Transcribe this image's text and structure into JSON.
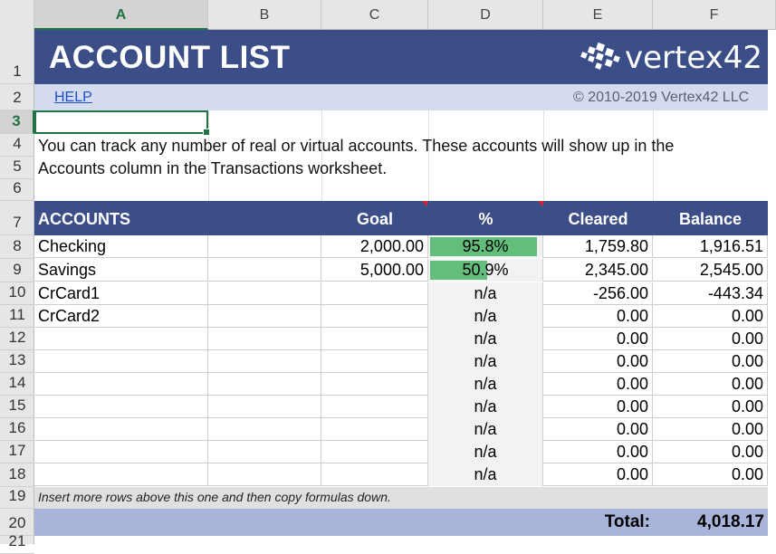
{
  "columns": [
    "A",
    "B",
    "C",
    "D",
    "E",
    "F"
  ],
  "row_numbers": [
    "1",
    "2",
    "3",
    "4",
    "5",
    "6",
    "7",
    "8",
    "9",
    "10",
    "11",
    "12",
    "13",
    "14",
    "15",
    "16",
    "17",
    "18",
    "19",
    "20",
    "21"
  ],
  "active_column": "A",
  "active_row": "3",
  "banner": {
    "title": "ACCOUNT LIST",
    "logo_text": "vertex42",
    "help_link": "HELP",
    "copyright": "© 2010-2019 Vertex42 LLC",
    "banner_color": "#3b4e87",
    "subbar_color": "#d5dbee"
  },
  "description": [
    "You can track any number of real or virtual accounts. These accounts will show up in the",
    "Accounts column in the Transactions worksheet."
  ],
  "table": {
    "headers": [
      "ACCOUNTS",
      "Goal",
      "%",
      "Cleared",
      "Balance"
    ],
    "rows": [
      {
        "account": "Checking",
        "goal": "2,000.00",
        "pct": "95.8%",
        "pct_fill": 0.958,
        "cleared": "1,759.80",
        "balance": "1,916.51"
      },
      {
        "account": "Savings",
        "goal": "5,000.00",
        "pct": "50.9%",
        "pct_fill": 0.509,
        "cleared": "2,345.00",
        "balance": "2,545.00"
      },
      {
        "account": "CrCard1",
        "goal": "",
        "pct": "n/a",
        "pct_fill": 0,
        "cleared": "-256.00",
        "balance": "-443.34"
      },
      {
        "account": "CrCard2",
        "goal": "",
        "pct": "n/a",
        "pct_fill": 0,
        "cleared": "0.00",
        "balance": "0.00"
      },
      {
        "account": "",
        "goal": "",
        "pct": "n/a",
        "pct_fill": 0,
        "cleared": "0.00",
        "balance": "0.00"
      },
      {
        "account": "",
        "goal": "",
        "pct": "n/a",
        "pct_fill": 0,
        "cleared": "0.00",
        "balance": "0.00"
      },
      {
        "account": "",
        "goal": "",
        "pct": "n/a",
        "pct_fill": 0,
        "cleared": "0.00",
        "balance": "0.00"
      },
      {
        "account": "",
        "goal": "",
        "pct": "n/a",
        "pct_fill": 0,
        "cleared": "0.00",
        "balance": "0.00"
      },
      {
        "account": "",
        "goal": "",
        "pct": "n/a",
        "pct_fill": 0,
        "cleared": "0.00",
        "balance": "0.00"
      },
      {
        "account": "",
        "goal": "",
        "pct": "n/a",
        "pct_fill": 0,
        "cleared": "0.00",
        "balance": "0.00"
      },
      {
        "account": "",
        "goal": "",
        "pct": "n/a",
        "pct_fill": 0,
        "cleared": "0.00",
        "balance": "0.00"
      }
    ],
    "bar_color": "#63be7b"
  },
  "note": "Insert more rows above this one and then copy formulas down.",
  "total": {
    "label": "Total:",
    "value": "4,018.17"
  }
}
